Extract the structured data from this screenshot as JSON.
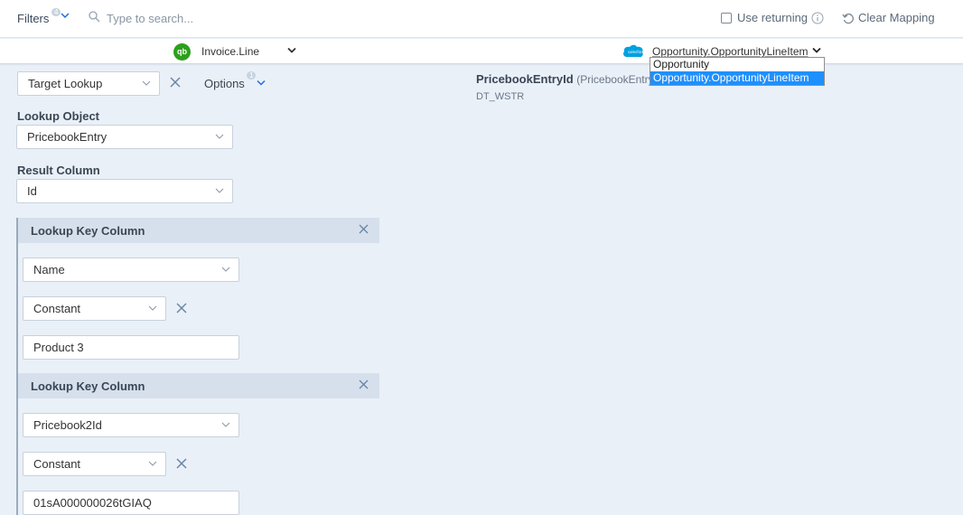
{
  "toolbar": {
    "filters_label": "Filters",
    "filters_count": "4",
    "search_placeholder": "Type to search...",
    "use_returning_label": "Use returning",
    "clear_mapping_label": "Clear Mapping"
  },
  "objects": {
    "source": "Invoice.Line",
    "target": "Opportunity.OpportunityLineItem",
    "target_options": [
      "Opportunity",
      "Opportunity.OpportunityLineItem"
    ],
    "target_selected_index": 1
  },
  "mapping": {
    "type_value": "Target Lookup",
    "options_label": "Options",
    "options_count": "1",
    "lookup_object_label": "Lookup Object",
    "lookup_object_value": "PricebookEntry",
    "result_column_label": "Result Column",
    "result_column_value": "Id",
    "lookup_keys": [
      {
        "title": "Lookup Key Column",
        "column": "Name",
        "source_type": "Constant",
        "value": "Product 3"
      },
      {
        "title": "Lookup Key Column",
        "column": "Pricebook2Id",
        "source_type": "Constant",
        "value": "01sA000000026tGIAQ"
      }
    ]
  },
  "target_field": {
    "name": "PricebookEntryId",
    "sub": "(PricebookEntry)",
    "type": "DT_WSTR"
  },
  "colors": {
    "accent": "#1e90ff",
    "quickbooks": "#2ca01c",
    "salesforce": "#00a1e0",
    "background": "#eaf0f8"
  },
  "icons": {
    "quickbooks": "qb",
    "salesforce": "salesforce"
  }
}
